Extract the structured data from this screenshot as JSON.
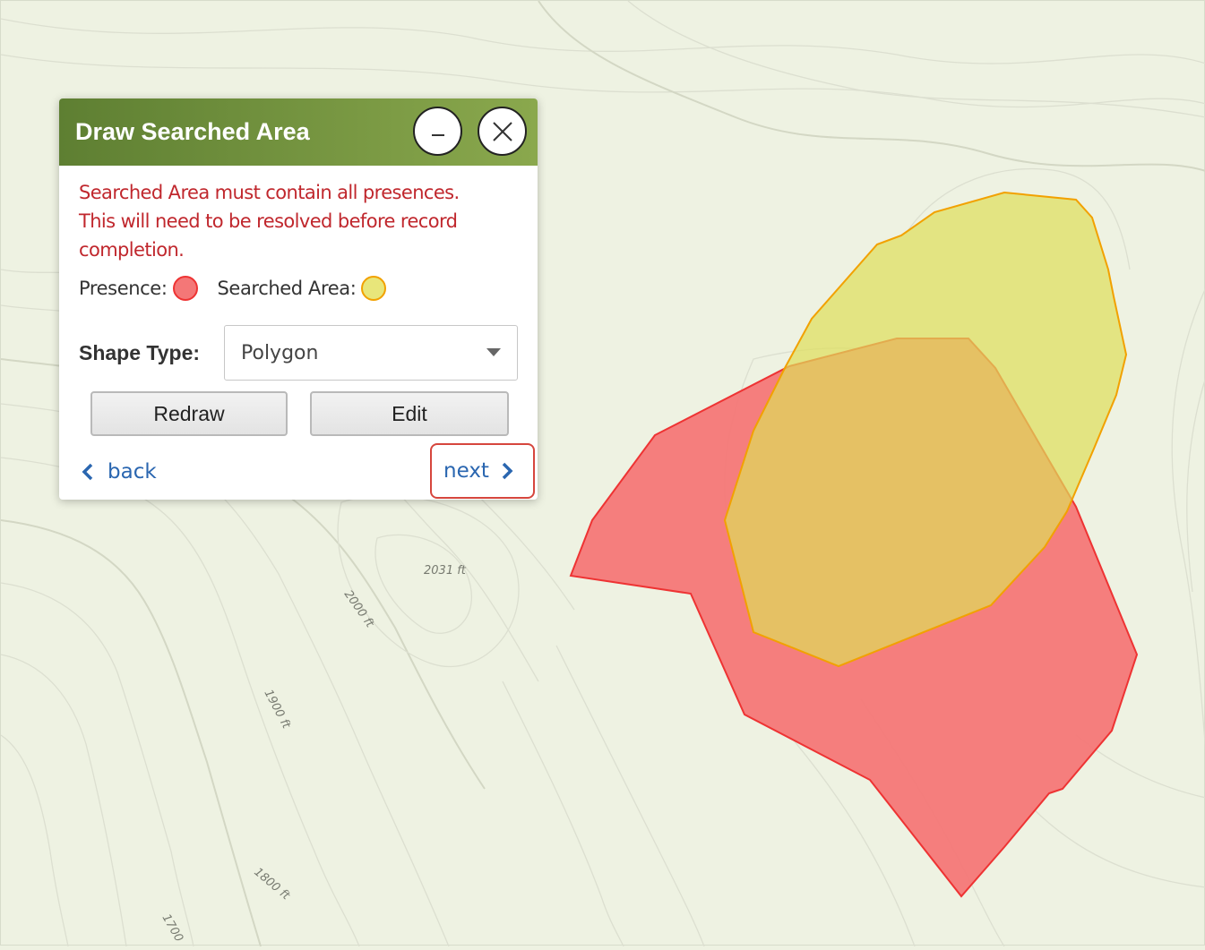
{
  "panel": {
    "title": "Draw Searched Area",
    "minimize_icon": "minimize-icon",
    "close_icon": "close-icon",
    "warning_line1": "Searched Area must contain all presences.",
    "warning_line2": "This will need to be resolved before record",
    "warning_line3": "completion.",
    "legend": {
      "presence_label": "Presence:",
      "searched_label": "Searched Area:",
      "presence_color": "#f47777",
      "searched_color": "#e8e67a"
    },
    "shape_type_label": "Shape Type:",
    "shape_type_value": "Polygon",
    "redraw_label": "Redraw",
    "edit_label": "Edit",
    "back_label": "back",
    "next_label": "next",
    "header_color_start": "#5e7f32",
    "header_color_end": "#8aa84d",
    "link_color": "#2a66b0",
    "warning_color": "#c0272d"
  },
  "map": {
    "elevation_labels": [
      "2031 ft",
      "2000 ft",
      "1900 ft",
      "1800 ft",
      "1700"
    ],
    "presence_fill": "#f47777",
    "presence_stroke": "#ee3333",
    "searched_fill": "#dede5a",
    "searched_stroke": "#f2a100"
  }
}
